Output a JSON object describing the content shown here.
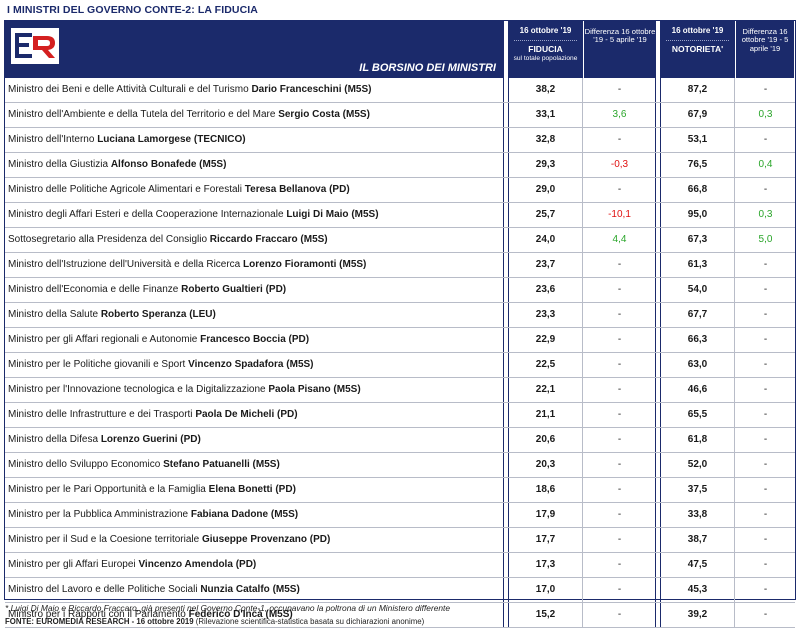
{
  "title": "I MINISTRI DEL GOVERNO CONTE-2: LA FIDUCIA",
  "header": {
    "banner": "IL BORSINO DEI MINISTRI",
    "fiducia_date": "16 ottobre '19",
    "fiducia_label": "FIDUCIA",
    "fiducia_sub": "sul totale popolazione",
    "diff_fiducia": "Differenza 16 ottobre '19 - 5 aprile '19",
    "notorieta_date": "16 ottobre '19",
    "notorieta_label": "NOTORIETA'",
    "diff_notorieta": "Differenza 16 ottobre '19 - 5 aprile '19"
  },
  "colors": {
    "navy": "#1b2a6b",
    "positive": "#2aa52a",
    "negative": "#e01010",
    "logo_red": "#d42020"
  },
  "chart_data": {
    "type": "table",
    "columns": [
      "Ministro",
      "Fiducia (16 ottobre '19)",
      "Differenza Fiducia",
      "Notorieta' (16 ottobre '19)",
      "Differenza Notorieta'"
    ],
    "rows": [
      {
        "role": "Ministro dei Beni e delle Attività Culturali e del Turismo",
        "name": "Dario Franceschini",
        "party": "(M5S)",
        "fiducia": "38,2",
        "diff_fiducia": "-",
        "notorieta": "87,2",
        "diff_notorieta": "-"
      },
      {
        "role": "Ministro dell'Ambiente e della Tutela del Territorio e del Mare",
        "name": "Sergio Costa",
        "party": "(M5S)",
        "fiducia": "33,1",
        "diff_fiducia": "3,6",
        "notorieta": "67,9",
        "diff_notorieta": "0,3"
      },
      {
        "role": "Ministro dell'Interno",
        "name": "Luciana Lamorgese",
        "party": "(TECNICO)",
        "fiducia": "32,8",
        "diff_fiducia": "-",
        "notorieta": "53,1",
        "diff_notorieta": "-"
      },
      {
        "role": "Ministro della Giustizia",
        "name": "Alfonso Bonafede",
        "party": "(M5S)",
        "fiducia": "29,3",
        "diff_fiducia": "-0,3",
        "notorieta": "76,5",
        "diff_notorieta": "0,4"
      },
      {
        "role": "Ministro delle Politiche Agricole Alimentari e Forestali",
        "name": "Teresa Bellanova",
        "party": "(PD)",
        "fiducia": "29,0",
        "diff_fiducia": "-",
        "notorieta": "66,8",
        "diff_notorieta": "-"
      },
      {
        "role": "Ministro degli Affari Esteri e della Cooperazione Internazionale",
        "name": "Luigi Di Maio",
        "party": "(M5S)",
        "fiducia": "25,7",
        "diff_fiducia": "-10,1",
        "notorieta": "95,0",
        "diff_notorieta": "0,3"
      },
      {
        "role": "Sottosegretario alla Presidenza del Consiglio",
        "name": "Riccardo Fraccaro",
        "party": "(M5S)",
        "fiducia": "24,0",
        "diff_fiducia": "4,4",
        "notorieta": "67,3",
        "diff_notorieta": "5,0"
      },
      {
        "role": "Ministro dell'Istruzione dell'Università e della Ricerca",
        "name": "Lorenzo Fioramonti",
        "party": "(M5S)",
        "fiducia": "23,7",
        "diff_fiducia": "-",
        "notorieta": "61,3",
        "diff_notorieta": "-"
      },
      {
        "role": "Ministro dell'Economia e delle Finanze",
        "name": "Roberto Gualtieri",
        "party": "(PD)",
        "fiducia": "23,6",
        "diff_fiducia": "-",
        "notorieta": "54,0",
        "diff_notorieta": "-"
      },
      {
        "role": "Ministro della Salute",
        "name": "Roberto Speranza",
        "party": "(LEU)",
        "fiducia": "23,3",
        "diff_fiducia": "-",
        "notorieta": "67,7",
        "diff_notorieta": "-"
      },
      {
        "role": "Ministro per gli Affari regionali e Autonomie",
        "name": "Francesco Boccia",
        "party": "(PD)",
        "fiducia": "22,9",
        "diff_fiducia": "-",
        "notorieta": "66,3",
        "diff_notorieta": "-"
      },
      {
        "role": "Ministro per le Politiche giovanili e Sport",
        "name": "Vincenzo Spadafora",
        "party": "(M5S)",
        "fiducia": "22,5",
        "diff_fiducia": "-",
        "notorieta": "63,0",
        "diff_notorieta": "-"
      },
      {
        "role": "Ministro per l'Innovazione tecnologica e la Digitalizzazione",
        "name": "Paola Pisano",
        "party": "(M5S)",
        "fiducia": "22,1",
        "diff_fiducia": "-",
        "notorieta": "46,6",
        "diff_notorieta": "-"
      },
      {
        "role": "Ministro delle Infrastrutture e dei Trasporti",
        "name": "Paola De Micheli",
        "party": "(PD)",
        "fiducia": "21,1",
        "diff_fiducia": "-",
        "notorieta": "65,5",
        "diff_notorieta": "-"
      },
      {
        "role": "Ministro della Difesa",
        "name": "Lorenzo Guerini",
        "party": "(PD)",
        "fiducia": "20,6",
        "diff_fiducia": "-",
        "notorieta": "61,8",
        "diff_notorieta": "-"
      },
      {
        "role": "Ministro dello Sviluppo Economico",
        "name": "Stefano Patuanelli",
        "party": "(M5S)",
        "fiducia": "20,3",
        "diff_fiducia": "-",
        "notorieta": "52,0",
        "diff_notorieta": "-"
      },
      {
        "role": "Ministro per le Pari Opportunità e la Famiglia",
        "name": "Elena Bonetti",
        "party": "(PD)",
        "fiducia": "18,6",
        "diff_fiducia": "-",
        "notorieta": "37,5",
        "diff_notorieta": "-"
      },
      {
        "role": "Ministro per la Pubblica Amministrazione",
        "name": "Fabiana Dadone",
        "party": "(M5S)",
        "fiducia": "17,9",
        "diff_fiducia": "-",
        "notorieta": "33,8",
        "diff_notorieta": "-"
      },
      {
        "role": "Ministro per il Sud e la Coesione territoriale",
        "name": "Giuseppe Provenzano",
        "party": "(PD)",
        "fiducia": "17,7",
        "diff_fiducia": "-",
        "notorieta": "38,7",
        "diff_notorieta": "-"
      },
      {
        "role": "Ministro per gli Affari Europei",
        "name": "Vincenzo Amendola",
        "party": "(PD)",
        "fiducia": "17,3",
        "diff_fiducia": "-",
        "notorieta": "47,5",
        "diff_notorieta": "-"
      },
      {
        "role": "Ministro del Lavoro e delle Politiche Sociali",
        "name": "Nunzia Catalfo",
        "party": "(M5S)",
        "fiducia": "17,0",
        "diff_fiducia": "-",
        "notorieta": "45,3",
        "diff_notorieta": "-"
      },
      {
        "role": "Ministro per i Rapporti con il Parlamento",
        "name": "Federico D'Incà",
        "party": "(M5S)",
        "fiducia": "15,2",
        "diff_fiducia": "-",
        "notorieta": "39,2",
        "diff_notorieta": "-"
      }
    ]
  },
  "footnote": "* Luigi Di Maio e Riccardo Fraccaro, già presenti nel Governo Conte-1, occupavano la poltrona di un Ministero differente",
  "source_label": "FONTE: EUROMEDIA RESEARCH - 16 ottobre 2019",
  "source_note": "(Rilevazione scientifica-statistica basata su dichiarazioni anonime)"
}
